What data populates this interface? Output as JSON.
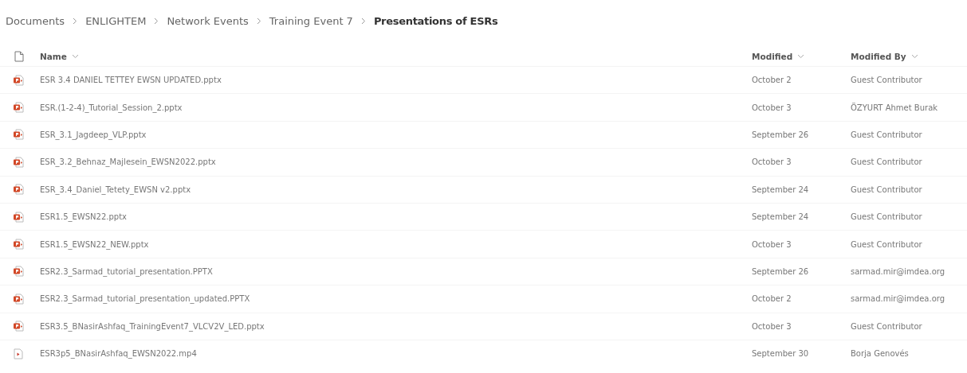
{
  "breadcrumb": [
    {
      "label": "Documents",
      "current": false
    },
    {
      "label": "ENLIGHTEM",
      "current": false
    },
    {
      "label": "Network Events",
      "current": false
    },
    {
      "label": "Training Event 7",
      "current": false
    },
    {
      "label": "Presentations of ESRs",
      "current": true
    }
  ],
  "table": {
    "columns": [
      {
        "label": "Name"
      },
      {
        "label": "Modified"
      },
      {
        "label": "Modified By"
      }
    ],
    "rows": [
      {
        "kind": "pptx",
        "name": "ESR 3.4 DANIEL TETTEY EWSN UPDATED.pptx",
        "modified": "October 2",
        "modified_by": "Guest Contributor"
      },
      {
        "kind": "pptx",
        "name": "ESR.(1-2-4)_Tutorial_Session_2.pptx",
        "modified": "October 3",
        "modified_by": "ÖZYURT Ahmet Burak"
      },
      {
        "kind": "pptx",
        "name": "ESR_3.1_Jagdeep_VLP.pptx",
        "modified": "September 26",
        "modified_by": "Guest Contributor"
      },
      {
        "kind": "pptx",
        "name": "ESR_3.2_Behnaz_Majlesein_EWSN2022.pptx",
        "modified": "October 3",
        "modified_by": "Guest Contributor"
      },
      {
        "kind": "pptx",
        "name": "ESR_3.4_Daniel_Tetety_EWSN v2.pptx",
        "modified": "September 24",
        "modified_by": "Guest Contributor"
      },
      {
        "kind": "pptx",
        "name": "ESR1.5_EWSN22.pptx",
        "modified": "September 24",
        "modified_by": "Guest Contributor"
      },
      {
        "kind": "pptx",
        "name": "ESR1.5_EWSN22_NEW.pptx",
        "modified": "October 3",
        "modified_by": "Guest Contributor"
      },
      {
        "kind": "pptx",
        "name": "ESR2.3_Sarmad_tutorial_presentation.PPTX",
        "modified": "September 26",
        "modified_by": "sarmad.mir@imdea.org"
      },
      {
        "kind": "pptx",
        "name": "ESR2.3_Sarmad_tutorial_presentation_updated.PPTX",
        "modified": "October 2",
        "modified_by": "sarmad.mir@imdea.org"
      },
      {
        "kind": "pptx",
        "name": "ESR3.5_BNasirAshfaq_TrainingEvent7_VLCV2V_LED.pptx",
        "modified": "October 3",
        "modified_by": "Guest Contributor"
      },
      {
        "kind": "video",
        "name": "ESR3p5_BNasirAshfaq_EWSN2022.mp4",
        "modified": "September 30",
        "modified_by": "Borja Genovés"
      }
    ]
  }
}
